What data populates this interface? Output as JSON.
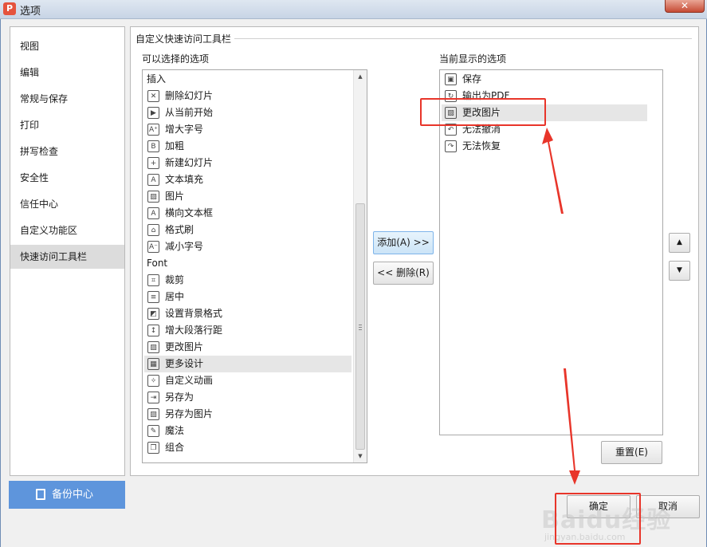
{
  "window": {
    "title": "选项",
    "close_symbol": "✕",
    "app_icon_glyph": "P"
  },
  "sidebar": {
    "items": [
      {
        "label": "视图"
      },
      {
        "label": "编辑"
      },
      {
        "label": "常规与保存"
      },
      {
        "label": "打印"
      },
      {
        "label": "拼写检查"
      },
      {
        "label": "安全性"
      },
      {
        "label": "信任中心"
      },
      {
        "label": "自定义功能区"
      },
      {
        "label": "快速访问工具栏",
        "selected": true
      }
    ],
    "backup_label": "备份中心"
  },
  "panel": {
    "group_title": "自定义快速访问工具栏",
    "available_label": "可以选择的选项",
    "current_label": "当前显示的选项"
  },
  "available_list": [
    {
      "label": "插入",
      "header": true
    },
    {
      "label": "删除幻灯片",
      "icon": "delete-slide-icon",
      "glyph": "✕"
    },
    {
      "label": "从当前开始",
      "icon": "play-from-current-icon",
      "glyph": "▶"
    },
    {
      "label": "增大字号",
      "icon": "font-increase-icon",
      "glyph": "A⁺"
    },
    {
      "label": "加粗",
      "icon": "bold-icon",
      "glyph": "B"
    },
    {
      "label": "新建幻灯片",
      "icon": "new-slide-icon",
      "glyph": "+"
    },
    {
      "label": "文本填充",
      "icon": "text-fill-icon",
      "glyph": "A"
    },
    {
      "label": "图片",
      "icon": "picture-icon",
      "glyph": "▨"
    },
    {
      "label": "横向文本框",
      "icon": "horizontal-textbox-icon",
      "glyph": "A"
    },
    {
      "label": "格式刷",
      "icon": "format-painter-icon",
      "glyph": "⌂"
    },
    {
      "label": "减小字号",
      "icon": "font-decrease-icon",
      "glyph": "A⁻"
    },
    {
      "label": "Font",
      "header": true
    },
    {
      "label": "裁剪",
      "icon": "crop-icon",
      "glyph": "⌗"
    },
    {
      "label": "居中",
      "icon": "align-center-icon",
      "glyph": "≡"
    },
    {
      "label": "设置背景格式",
      "icon": "background-format-icon",
      "glyph": "◩"
    },
    {
      "label": "增大段落行距",
      "icon": "line-spacing-icon",
      "glyph": "↕"
    },
    {
      "label": "更改图片",
      "icon": "change-picture-icon",
      "glyph": "▨"
    },
    {
      "label": "更多设计",
      "icon": "more-design-icon",
      "glyph": "▦",
      "selected": true
    },
    {
      "label": "自定义动画",
      "icon": "custom-animation-icon",
      "glyph": "✧"
    },
    {
      "label": "另存为",
      "icon": "save-as-icon",
      "glyph": "⇥"
    },
    {
      "label": "另存为图片",
      "icon": "save-as-picture-icon",
      "glyph": "▨"
    },
    {
      "label": "魔法",
      "icon": "magic-wand-icon",
      "glyph": "✎"
    },
    {
      "label": "组合",
      "icon": "group-icon",
      "glyph": "❐"
    }
  ],
  "current_list": [
    {
      "label": "保存",
      "icon": "save-icon",
      "glyph": "▣"
    },
    {
      "label": "输出为PDF",
      "icon": "export-pdf-icon",
      "glyph": "↻"
    },
    {
      "label": "更改图片",
      "icon": "change-picture-icon",
      "glyph": "▨",
      "selected": true
    },
    {
      "label": "无法撤消",
      "icon": "undo-icon",
      "glyph": "↶"
    },
    {
      "label": "无法恢复",
      "icon": "redo-icon",
      "glyph": "↷"
    }
  ],
  "buttons": {
    "add": "添加(A) >>",
    "remove": "<< 删除(R)",
    "move_up_glyph": "▲",
    "move_down_glyph": "▼",
    "reset": "重置(E)",
    "ok": "确定",
    "cancel": "取消"
  },
  "scroll_glyphs": {
    "up": "▲",
    "down": "▼"
  },
  "watermark": {
    "brand": "Baidu经验",
    "url": "jingyan.baidu.com"
  },
  "colors": {
    "accent_blue": "#5e95dc",
    "annotation_red": "#e8352a",
    "selection_gray": "#e6e6e6"
  }
}
